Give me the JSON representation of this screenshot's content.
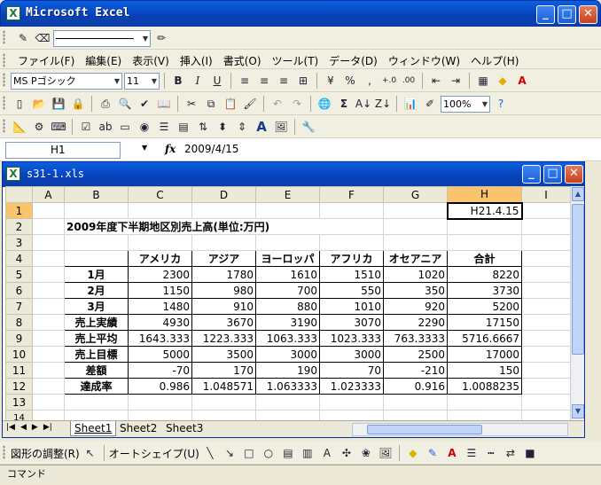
{
  "app": {
    "title": "Microsoft Excel",
    "icon": "excel-app-icon"
  },
  "window_controls": {
    "minimize": "_",
    "maximize": "□",
    "close": "✕"
  },
  "menu": [
    "ファイル(F)",
    "編集(E)",
    "表示(V)",
    "挿入(I)",
    "書式(O)",
    "ツール(T)",
    "データ(D)",
    "ウィンドウ(W)",
    "ヘルプ(H)"
  ],
  "format_toolbar": {
    "font_name": "MS Pゴシック",
    "font_size": "11",
    "bold": "B",
    "italic": "I",
    "underline": "U"
  },
  "standard_toolbar": {
    "zoom": "100%",
    "sum": "Σ",
    "percent": "%",
    "comma": ","
  },
  "formula_bar": {
    "cell_ref": "H1",
    "fx": "fx",
    "value": "2009/4/15"
  },
  "workbook": {
    "filename": "s31-1.xls"
  },
  "columns": [
    "A",
    "B",
    "C",
    "D",
    "E",
    "F",
    "G",
    "H",
    "I"
  ],
  "rows": [
    "1",
    "2",
    "3",
    "4",
    "5",
    "6",
    "7",
    "8",
    "9",
    "10",
    "11",
    "12",
    "13",
    "14"
  ],
  "cells": {
    "h1": "H21.4.15",
    "b2": "2009年度下半期地区別売上高(単位:万円)",
    "headers": [
      "アメリカ",
      "アジア",
      "ヨーロッパ",
      "アフリカ",
      "オセアニア",
      "合計"
    ],
    "table": [
      {
        "label": "1月",
        "values": [
          "2300",
          "1780",
          "1610",
          "1510",
          "1020",
          "8220"
        ]
      },
      {
        "label": "2月",
        "values": [
          "1150",
          "980",
          "700",
          "550",
          "350",
          "3730"
        ]
      },
      {
        "label": "3月",
        "values": [
          "1480",
          "910",
          "880",
          "1010",
          "920",
          "5200"
        ]
      },
      {
        "label": "売上実績",
        "values": [
          "4930",
          "3670",
          "3190",
          "3070",
          "2290",
          "17150"
        ]
      },
      {
        "label": "売上平均",
        "values": [
          "1643.333",
          "1223.333",
          "1063.333",
          "1023.333",
          "763.3333",
          "5716.6667"
        ]
      },
      {
        "label": "売上目標",
        "values": [
          "5000",
          "3500",
          "3000",
          "3000",
          "2500",
          "17000"
        ]
      },
      {
        "label": "差額",
        "values": [
          "-70",
          "170",
          "190",
          "70",
          "-210",
          "150"
        ]
      },
      {
        "label": "達成率",
        "values": [
          "0.986",
          "1.048571",
          "1.063333",
          "1.023333",
          "0.916",
          "1.0088235"
        ]
      }
    ]
  },
  "sheets": [
    "Sheet1",
    "Sheet2",
    "Sheet3"
  ],
  "drawing_toolbar": {
    "draw": "図形の調整(R)",
    "autoshapes": "オートシェイプ(U)"
  },
  "status": "コマンド",
  "colors": {
    "titlebar": "#0a5fe0",
    "selected_header": "#f9c46b",
    "toolbar": "#f1efe2"
  }
}
